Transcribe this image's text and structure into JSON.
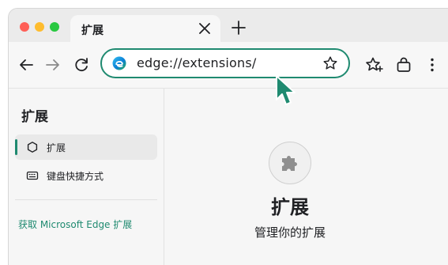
{
  "tab": {
    "title": "扩展"
  },
  "address_bar": {
    "url": "edge://extensions/"
  },
  "sidebar": {
    "title": "扩展",
    "items": [
      {
        "label": "扩展",
        "icon": "extension-icon",
        "active": true
      },
      {
        "label": "键盘快捷方式",
        "icon": "keyboard-icon",
        "active": false
      }
    ],
    "link": "获取 Microsoft Edge 扩展"
  },
  "main": {
    "icon": "puzzle-piece-icon",
    "title": "扩展",
    "subtitle": "管理你的扩展"
  },
  "colors": {
    "accent": "#1f8a70",
    "traffic_red": "#ff5f57",
    "traffic_yellow": "#febc2e",
    "traffic_green": "#28c840"
  }
}
